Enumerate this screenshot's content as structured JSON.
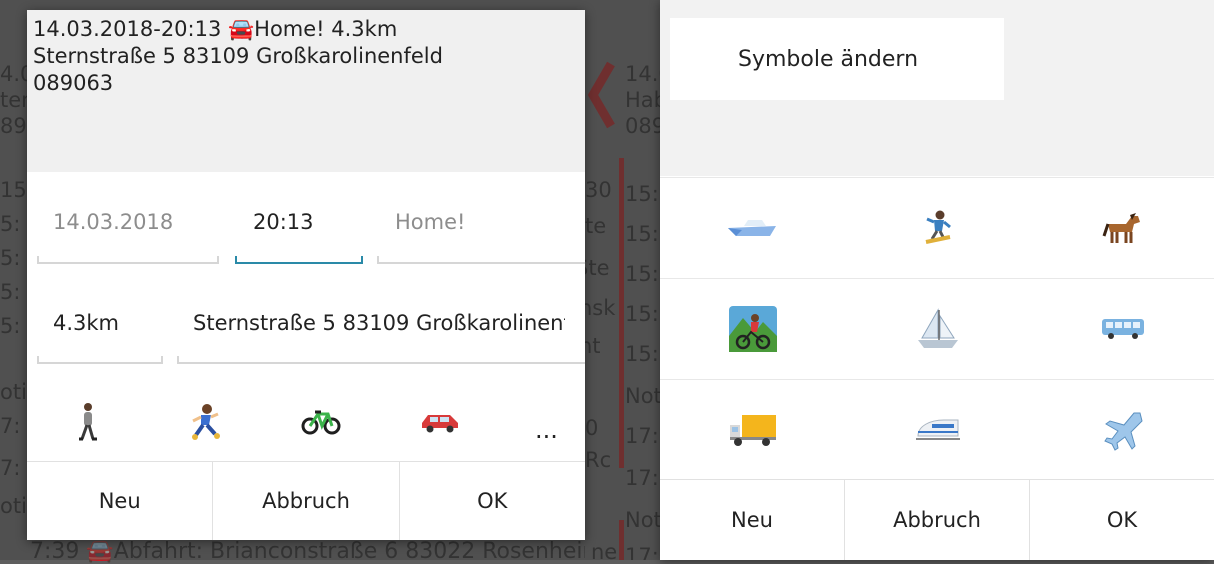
{
  "background_app": {
    "left_lines": [
      "4.0",
      "ter",
      "89",
      "15:",
      "5:",
      "5:",
      "5:",
      "5:",
      "oti",
      "7:",
      "7:",
      "oti"
    ],
    "bottom_text": "7:39 🚘Abfahrt: Brianconstraße 6 83022 Rosenheim",
    "middle_lines": [
      "14.0",
      "Hab",
      "089",
      "15:",
      "15:",
      "15:",
      "15:",
      "15:",
      "Noti",
      "17:",
      "17:",
      "Noti",
      "17:"
    ],
    "right_edge_fragments": [
      "30",
      "te",
      "Ste",
      "nsk",
      "sk",
      "ht",
      "0",
      "Rc",
      "ne"
    ]
  },
  "left_dialog": {
    "header_line1": "14.03.2018-20:13 🚘Home! 4.3km",
    "header_line2": "Sternstraße 5 83109 Großkarolinenfeld",
    "header_line3": "089063",
    "date_value": "14.03.2018",
    "time_value": "20:13",
    "label_value": "Home!",
    "distance_value": "4.3km",
    "address_value": "Sternstraße 5 83109 Großkarolinenfeld",
    "more_label": "...",
    "icons": [
      "walking-icon",
      "running-icon",
      "bicycle-icon",
      "car-icon"
    ],
    "buttons": {
      "new": "Neu",
      "cancel": "Abbruch",
      "ok": "OK"
    }
  },
  "right_dialog": {
    "title": "Symbole ändern",
    "icons": [
      [
        "speedboat-icon",
        "snowboarder-icon",
        "horse-icon"
      ],
      [
        "mountain-bicyclist-icon",
        "sailboat-icon",
        "bus-icon"
      ],
      [
        "delivery-truck-icon",
        "high-speed-train-icon",
        "airplane-icon"
      ]
    ],
    "buttons": {
      "new": "Neu",
      "cancel": "Abbruch",
      "ok": "OK"
    }
  },
  "colors": {
    "accent": "#2a8aa8",
    "background_red": "#a31515",
    "car_red": "#d83a3a"
  }
}
